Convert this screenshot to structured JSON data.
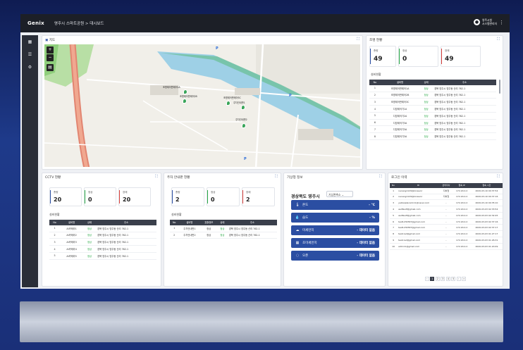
{
  "header": {
    "brand": "Genix",
    "breadcrumb": "영주시 스마트공원 > 대시보드",
    "user_name": "영주시청",
    "user_role": "시스템관리자"
  },
  "sidebar": {
    "items": [
      {
        "icon": "grid-icon"
      },
      {
        "icon": "list-icon"
      },
      {
        "icon": "gear-icon"
      }
    ]
  },
  "map": {
    "title": "지도",
    "markers": [
      {
        "label": "조명제어판제어1A"
      },
      {
        "label": "조명제어판제어2B"
      },
      {
        "label": "조명제어판제어3C"
      },
      {
        "label": "주차안내판1"
      },
      {
        "label": "주차안내판2"
      }
    ],
    "road_labels": [
      "P",
      "P",
      "P"
    ]
  },
  "lighting": {
    "title": "조명 현황",
    "stats": [
      {
        "label": "총량",
        "value": "49",
        "color": "#2b4ea2"
      },
      {
        "label": "정상",
        "value": "0",
        "color": "#27a845"
      },
      {
        "label": "장애",
        "value": "49",
        "color": "#d9413b"
      }
    ],
    "list_title": "설비현황",
    "columns": [
      "No",
      "설비명",
      "상태",
      "주소"
    ],
    "rows": [
      [
        "1",
        "조명제어판제어1A",
        "정상",
        "경북 영주시 영주동 산리 762-1"
      ],
      [
        "2",
        "조명제어판제어2B",
        "정상",
        "경북 영주시 영주동 산리 762-1"
      ],
      [
        "3",
        "조명제어판제어3C",
        "정상",
        "경북 영주시 영주동 산리 762-1"
      ],
      [
        "4",
        "디밍제어기1A",
        "정상",
        "경북 영주시 영주동 산리 762-1"
      ],
      [
        "5",
        "디밍제어기2A",
        "정상",
        "경북 영주시 영주동 산리 762-1"
      ],
      [
        "6",
        "디밍제어기3A",
        "정상",
        "경북 영주시 영주동 산리 762-1"
      ],
      [
        "7",
        "디밍제어기3A",
        "정상",
        "경북 영주시 영주동 산리 762-1"
      ],
      [
        "8",
        "디밍제어기3A",
        "정상",
        "경북 영주시 영주동 산리 762-1"
      ]
    ]
  },
  "cctv": {
    "title": "CCTV 현황",
    "stats": [
      {
        "label": "총량",
        "value": "20",
        "color": "#2b4ea2"
      },
      {
        "label": "정상",
        "value": "0",
        "color": "#27a845"
      },
      {
        "label": "장애",
        "value": "20",
        "color": "#d9413b"
      }
    ],
    "list_title": "설비현황",
    "columns": [
      "No",
      "설비명",
      "상태",
      "주소"
    ],
    "rows": [
      [
        "1",
        "AI카메라1",
        "정상",
        "경북 영주시 영주동 산리 762-1"
      ],
      [
        "2",
        "AI카메라2",
        "정상",
        "경북 영주시 영주동 산리 762-1"
      ],
      [
        "3",
        "AI카메라3",
        "정상",
        "경북 영주시 영주동 산리 762-1"
      ],
      [
        "4",
        "AI카메라4",
        "정상",
        "경북 영주시 영주동 산리 762-1"
      ],
      [
        "5",
        "AI카메라5",
        "정상",
        "경북 영주시 영주동 산리 762-1"
      ]
    ]
  },
  "parking": {
    "title": "주차 안내판 현황",
    "stats": [
      {
        "label": "총량",
        "value": "2",
        "color": "#2b4ea2"
      },
      {
        "label": "정상",
        "value": "0",
        "color": "#27a845"
      },
      {
        "label": "장애",
        "value": "2",
        "color": "#d9413b"
      }
    ],
    "list_title": "설비현황",
    "columns": [
      "No",
      "설비명",
      "표출정보",
      "상태",
      "주소"
    ],
    "rows": [
      [
        "1",
        "주차안내판1",
        "정상",
        "정상",
        "경북 영주시 영주동 산리 762-1"
      ],
      [
        "2",
        "주차안내판2",
        "정상",
        "정상",
        "경북 영주시 영주동 산리 762-1"
      ]
    ]
  },
  "weather": {
    "title": "기상청 정보",
    "location": "경상북도 영주시",
    "select_value": "기상관측소",
    "items": [
      {
        "icon": "thermometer-icon",
        "label": "온도",
        "value": "- ℃"
      },
      {
        "icon": "droplet-icon",
        "label": "습도",
        "value": "- %"
      },
      {
        "icon": "cloud-icon",
        "label": "미세먼지",
        "value": "- 데이터 없음"
      },
      {
        "icon": "dust-icon",
        "label": "초미세먼지",
        "value": "- 데이터 없음"
      },
      {
        "icon": "ozone-icon",
        "label": "오존",
        "value": "- 데이터 없음"
      }
    ]
  },
  "login": {
    "title": "로그인 이력",
    "columns": [
      "No",
      "ID",
      "관리자사",
      "접속 IP",
      "접속 시간"
    ],
    "rows": [
      [
        "1",
        "nenang1129@korea.kr",
        "지하철",
        "172.20.0.2",
        "2020-03-10 00:37:54"
      ],
      [
        "2",
        "nenang1129@korea.kr",
        "지하철",
        "172.20.0.2",
        "2020-03-10 00:37:16"
      ],
      [
        "3",
        "yellowplace1111@naver.com",
        "-",
        "172.20.0.2",
        "2020-03-10 00:35:10"
      ],
      [
        "4",
        "asdfasdf@gmail.com",
        "-",
        "172.20.0.2",
        "2020-03-03 02:33:54"
      ],
      [
        "5",
        "asdfasdf@gmail.com",
        "-",
        "172.20.0.2",
        "2020-03-03 02:32:45"
      ],
      [
        "6",
        "test1234567@gmail.com",
        "-",
        "172.20.0.2",
        "2020-03-03 02:37:16"
      ],
      [
        "7",
        "test1234567@gmail.com",
        "-",
        "172.20.0.2",
        "2020-03-03 02:37:17"
      ],
      [
        "8",
        "testcred@gmail.com",
        "-",
        "172.20.0.2",
        "2020-03-03 01:27:17"
      ],
      [
        "9",
        "testcred@gmail.com",
        "-",
        "172.20.0.2",
        "2020-03-03 01:26:31"
      ],
      [
        "10",
        "ad1111@gmail.com",
        "-",
        "172.20.0.2",
        "2020-03-03 01:20:49"
      ]
    ],
    "pages": [
      "‹",
      "1",
      "2",
      "3",
      "4",
      "5",
      "›",
      "»"
    ]
  }
}
